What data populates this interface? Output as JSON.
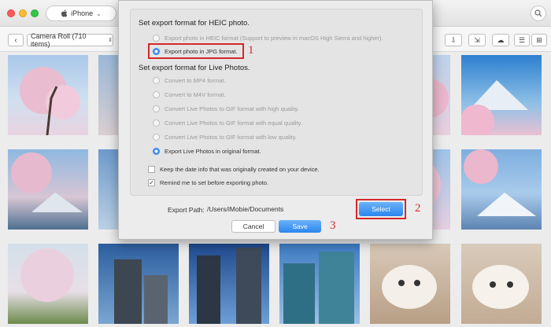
{
  "titlebar": {
    "device": "iPhone",
    "device_icon": "apple-icon",
    "chevron": "⌄",
    "search_icon": "⌕"
  },
  "toolbar": {
    "back_icon": "‹",
    "album": "Camera Roll (710 items)",
    "album_chevron": "⌃⌄",
    "tools": [
      "⇩",
      "⇲",
      "☁",
      "☰",
      "⊞"
    ]
  },
  "dialog": {
    "heic_title": "Set export format for HEIC photo.",
    "heic_options": [
      {
        "label": "Export photo in HEIC format (Support to preview in macOS High Sierra and higher).",
        "selected": false
      },
      {
        "label": "Export photo in JPG format.",
        "selected": true
      }
    ],
    "live_title": "Set export format for Live Photos.",
    "live_options": [
      {
        "label": "Convert to MP4 format.",
        "selected": false
      },
      {
        "label": "Convert to M4V format.",
        "selected": false
      },
      {
        "label": "Convert Live Photos to GIF format with high quality.",
        "selected": false
      },
      {
        "label": "Convert Live Photos to GIF format with equal quality.",
        "selected": false
      },
      {
        "label": "Convert Live Photos to GIF format with low quality.",
        "selected": false
      },
      {
        "label": "Export Live Photos in original format.",
        "selected": true
      }
    ],
    "checkboxes": [
      {
        "label": "Keep the date info that was originally created on your device.",
        "checked": false
      },
      {
        "label": "Remind me to set before exporting photo.",
        "checked": true
      }
    ],
    "export_path_label": "Export Path:",
    "export_path_value": "/Users/iMobie/Documents",
    "select_label": "Select",
    "cancel_label": "Cancel",
    "save_label": "Save",
    "step_numbers": [
      "1",
      "2",
      "3"
    ]
  },
  "colors": {
    "accent": "#2b86ee",
    "highlight": "#d4282a"
  }
}
